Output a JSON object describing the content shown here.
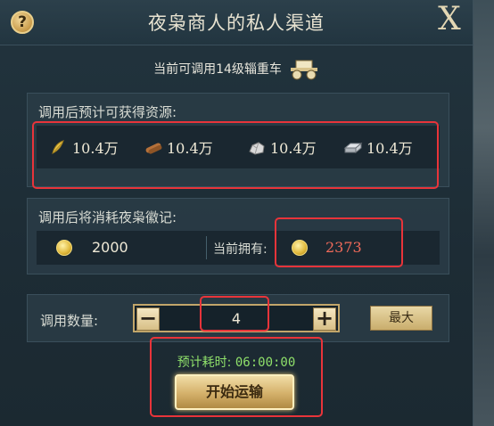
{
  "window": {
    "title": "夜枭商人的私人渠道",
    "help_icon": "?",
    "close_icon": "X"
  },
  "subtitle": "当前可调用14级辎重车",
  "resources": {
    "label": "调用后预计可获得资源:",
    "items": [
      {
        "icon": "grain-icon",
        "value": "10.4万"
      },
      {
        "icon": "wood-icon",
        "value": "10.4万"
      },
      {
        "icon": "stone-icon",
        "value": "10.4万"
      },
      {
        "icon": "iron-icon",
        "value": "10.4万"
      }
    ]
  },
  "cost": {
    "label": "调用后将消耗夜枭徽记:",
    "amount": "2000",
    "owned_label": "当前拥有:",
    "owned_value": "2373",
    "owned_color": "#f06a5a"
  },
  "quantity": {
    "label": "调用数量:",
    "minus": "−",
    "plus": "+",
    "value": "4",
    "max_label": "最大"
  },
  "eta": {
    "label": "预计耗时:",
    "value": "06:00:00"
  },
  "start_label": "开始运输",
  "colors": {
    "highlight": "#e8343a",
    "eta_text": "#8fe06a",
    "gold": "#c9ad6c"
  }
}
